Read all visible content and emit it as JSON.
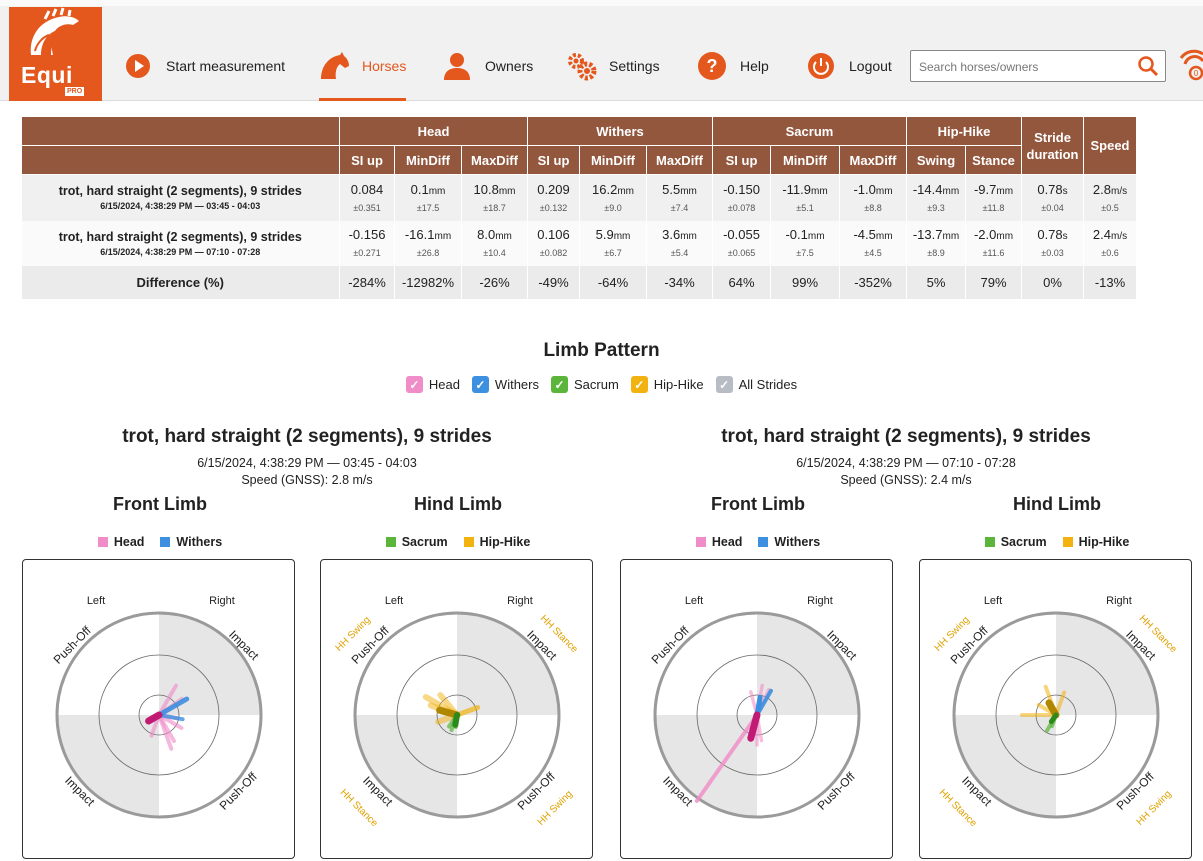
{
  "app": {
    "logo_text": "Equi",
    "logo_sub": "PRO"
  },
  "nav": {
    "start": "Start measurement",
    "horses": "Horses",
    "owners": "Owners",
    "settings": "Settings",
    "help": "Help",
    "logout": "Logout"
  },
  "search": {
    "placeholder": "Search horses/owners",
    "value": ""
  },
  "table": {
    "groups": [
      "Head",
      "Withers",
      "Sacrum",
      "Hip-Hike"
    ],
    "stride": "Stride duration",
    "speed": "Speed",
    "subcols": [
      "SI up",
      "MinDiff",
      "MaxDiff",
      "SI up",
      "MinDiff",
      "MaxDiff",
      "SI up",
      "MinDiff",
      "MaxDiff",
      "Swing",
      "Stance"
    ],
    "rows": [
      {
        "label": "trot, hard straight (2 segments), 9 strides",
        "sub": "6/15/2024, 4:38:29 PM — 03:45 - 04:03",
        "cells": [
          {
            "v": "0.084",
            "u": "",
            "sd": "±0.351"
          },
          {
            "v": "0.1",
            "u": "mm",
            "sd": "±17.5"
          },
          {
            "v": "10.8",
            "u": "mm",
            "sd": "±18.7"
          },
          {
            "v": "0.209",
            "u": "",
            "sd": "±0.132"
          },
          {
            "v": "16.2",
            "u": "mm",
            "sd": "±9.0"
          },
          {
            "v": "5.5",
            "u": "mm",
            "sd": "±7.4"
          },
          {
            "v": "-0.150",
            "u": "",
            "sd": "±0.078"
          },
          {
            "v": "-11.9",
            "u": "mm",
            "sd": "±5.1"
          },
          {
            "v": "-1.0",
            "u": "mm",
            "sd": "±8.8"
          },
          {
            "v": "-14.4",
            "u": "mm",
            "sd": "±9.3"
          },
          {
            "v": "-9.7",
            "u": "mm",
            "sd": "±11.8"
          },
          {
            "v": "0.78",
            "u": "s",
            "sd": "±0.04"
          },
          {
            "v": "2.8",
            "u": "m/s",
            "sd": "±0.5"
          }
        ]
      },
      {
        "label": "trot, hard straight (2 segments), 9 strides",
        "sub": "6/15/2024, 4:38:29 PM — 07:10 - 07:28",
        "cells": [
          {
            "v": "-0.156",
            "u": "",
            "sd": "±0.271"
          },
          {
            "v": "-16.1",
            "u": "mm",
            "sd": "±26.8"
          },
          {
            "v": "8.0",
            "u": "mm",
            "sd": "±10.4"
          },
          {
            "v": "0.106",
            "u": "",
            "sd": "±0.082"
          },
          {
            "v": "5.9",
            "u": "mm",
            "sd": "±6.7"
          },
          {
            "v": "3.6",
            "u": "mm",
            "sd": "±5.4"
          },
          {
            "v": "-0.055",
            "u": "",
            "sd": "±0.065"
          },
          {
            "v": "-0.1",
            "u": "mm",
            "sd": "±7.5"
          },
          {
            "v": "-4.5",
            "u": "mm",
            "sd": "±4.5"
          },
          {
            "v": "-13.7",
            "u": "mm",
            "sd": "±8.9"
          },
          {
            "v": "-2.0",
            "u": "mm",
            "sd": "±11.6"
          },
          {
            "v": "0.78",
            "u": "s",
            "sd": "±0.03"
          },
          {
            "v": "2.4",
            "u": "m/s",
            "sd": "±0.6"
          }
        ]
      }
    ],
    "diff_label": "Difference (%)",
    "diff": [
      "-284%",
      "-12982%",
      "-26%",
      "-49%",
      "-64%",
      "-34%",
      "64%",
      "99%",
      "-352%",
      "5%",
      "79%",
      "0%",
      "-13%"
    ]
  },
  "limb": {
    "title": "Limb Pattern",
    "filters": [
      {
        "label": "Head",
        "color": "#f08cc8",
        "checked": true
      },
      {
        "label": "Withers",
        "color": "#3d8fe0",
        "checked": true
      },
      {
        "label": "Sacrum",
        "color": "#5bb53b",
        "checked": true
      },
      {
        "label": "Hip-Hike",
        "color": "#f2b311",
        "checked": true
      },
      {
        "label": "All Strides",
        "color": "#b8bcc4",
        "checked": true
      }
    ],
    "groups": [
      {
        "title": "trot, hard straight (2 segments), 9 strides",
        "date": "6/15/2024, 4:38:29 PM — 03:45 - 04:03",
        "speed": "Speed (GNSS): 2.8 m/s"
      },
      {
        "title": "trot, hard straight (2 segments), 9 strides",
        "date": "6/15/2024, 4:38:29 PM — 07:10 - 07:28",
        "speed": "Speed (GNSS): 2.4 m/s"
      }
    ],
    "front_title": "Front Limb",
    "hind_title": "Hind Limb",
    "front_legend": [
      "Head",
      "Withers"
    ],
    "hind_legend": [
      "Sacrum",
      "Hip-Hike"
    ],
    "colors": {
      "head": "#f08cc8",
      "withers": "#3d8fe0",
      "sacrum": "#5bb53b",
      "hiphike": "#f2b311"
    },
    "polar": {
      "left": "Left",
      "right": "Right",
      "push_off": "Push-Off",
      "impact": "Impact",
      "hh_swing": "HH Swing",
      "hh_stance": "HH Stance"
    }
  }
}
